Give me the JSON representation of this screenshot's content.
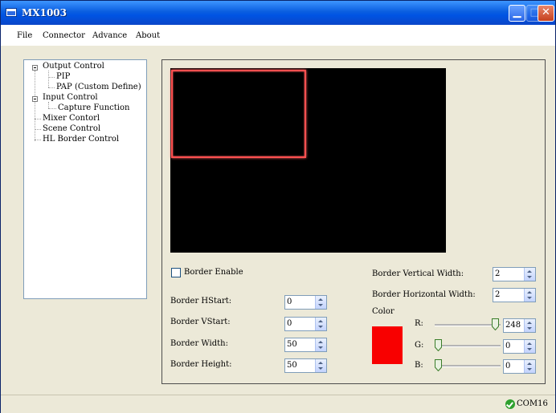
{
  "window": {
    "title": "MX1003"
  },
  "menu": {
    "items": [
      "File",
      "Connector",
      "Advance",
      "About"
    ]
  },
  "tree": {
    "items": [
      {
        "label": "Output Control"
      },
      {
        "label": "PIP"
      },
      {
        "label": "PAP (Custom Define)"
      },
      {
        "label": "Input Control"
      },
      {
        "label": "Capture Function"
      },
      {
        "label": "Mixer Contorl"
      },
      {
        "label": "Scene Control"
      },
      {
        "label": "HL Border Control"
      }
    ]
  },
  "border": {
    "enable_label": "Border Enable",
    "enable_checked": false,
    "hstart": {
      "label": "Border HStart:",
      "value": "0"
    },
    "vstart": {
      "label": "Border VStart:",
      "value": "0"
    },
    "width": {
      "label": "Border Width:",
      "value": "50"
    },
    "height": {
      "label": "Border Height:",
      "value": "50"
    },
    "vertical_width": {
      "label": "Border Vertical Width:",
      "value": "2"
    },
    "horizontal_width": {
      "label": "Border Horizontal Width:",
      "value": "2"
    }
  },
  "color": {
    "label": "Color",
    "swatch": "#f80000",
    "r": {
      "label": "R:",
      "value": "248",
      "level": 248,
      "max": 255
    },
    "g": {
      "label": "G:",
      "value": "0",
      "level": 0,
      "max": 255
    },
    "b": {
      "label": "B:",
      "value": "0",
      "level": 0,
      "max": 255
    }
  },
  "preview": {
    "background": "#000000",
    "highlight_color": "#ff5050"
  },
  "status": {
    "port": "COM16"
  }
}
